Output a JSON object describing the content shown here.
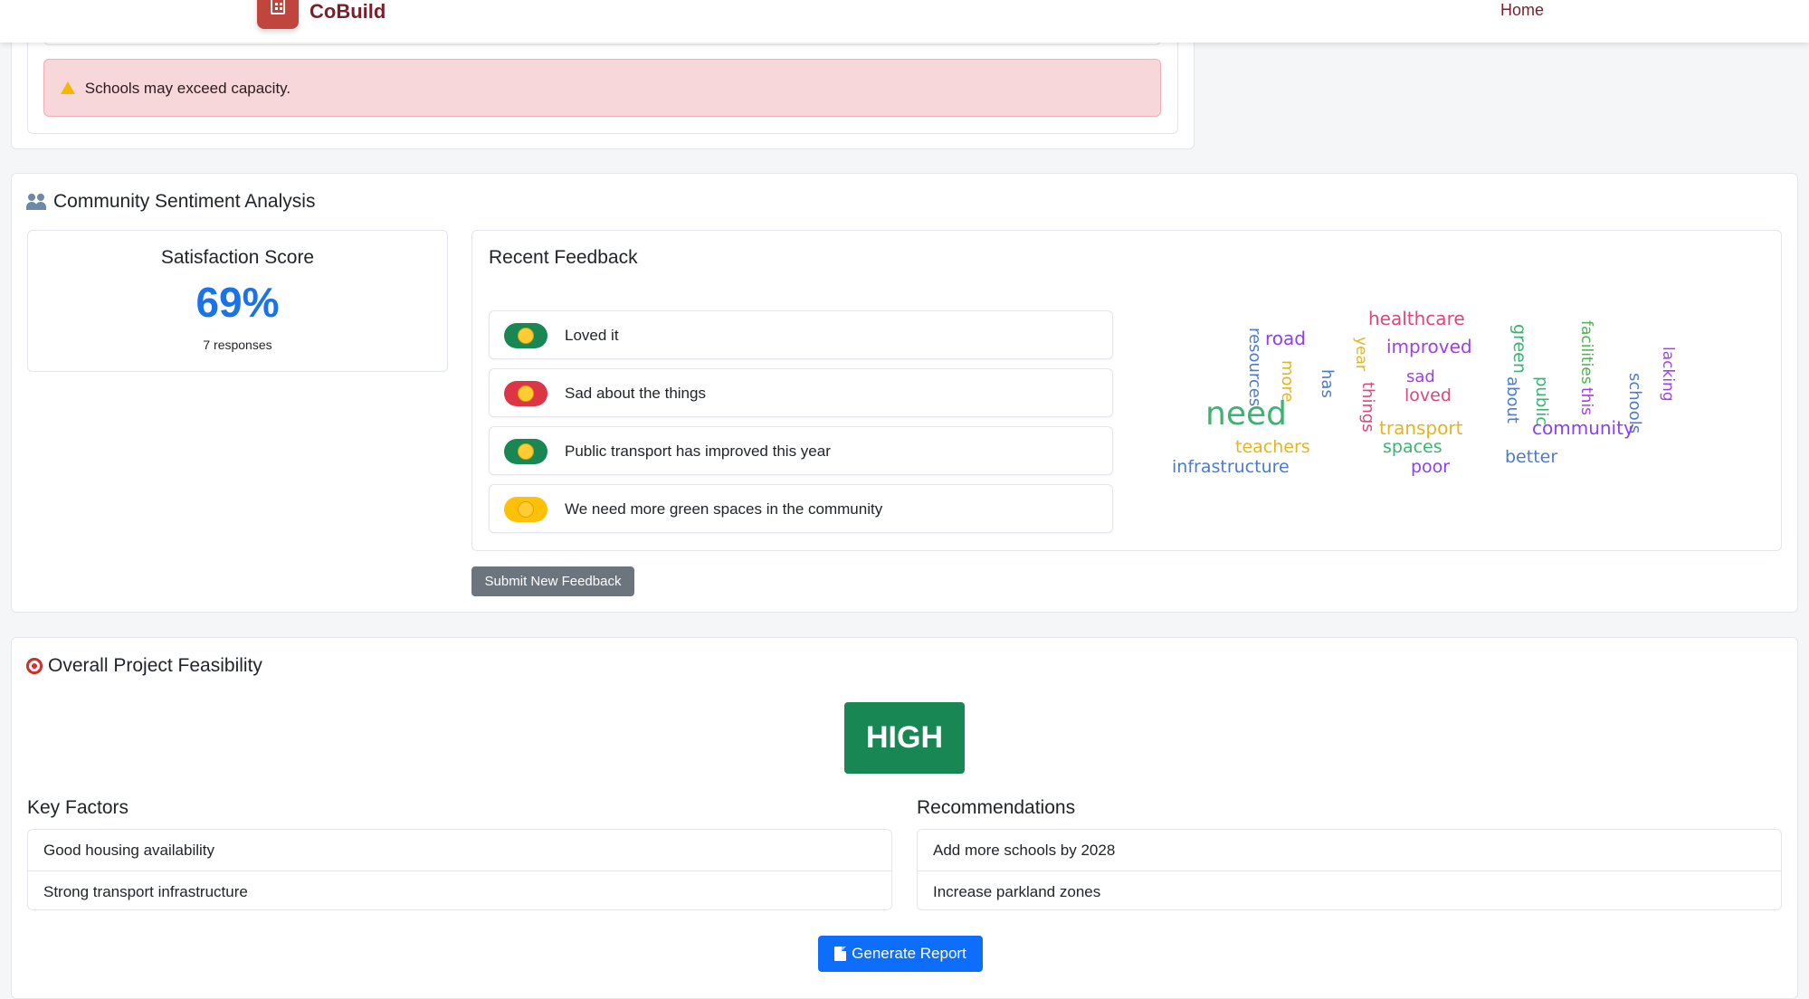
{
  "nav": {
    "brand": "CoBuild",
    "home_link": "Home"
  },
  "alert": {
    "text": "Schools may exceed capacity."
  },
  "sentiment": {
    "title": "Community Sentiment Analysis",
    "score_title": "Satisfaction Score",
    "score_value": "69%",
    "responses": "7 responses",
    "feedback_title": "Recent Feedback",
    "feedback": [
      {
        "text": "Loved it",
        "sentiment": "positive",
        "color": "#198754"
      },
      {
        "text": "Sad about the things",
        "sentiment": "negative",
        "color": "#dc3545"
      },
      {
        "text": "Public transport has improved this year",
        "sentiment": "positive",
        "color": "#198754"
      },
      {
        "text": "We need more green spaces in the community",
        "sentiment": "neutral",
        "color": "#ffc107"
      }
    ],
    "wordcloud": [
      "healthcare",
      "road",
      "resources",
      "year",
      "improved",
      "green",
      "facilities",
      "lacking",
      "more",
      "has",
      "sad",
      "loved",
      "about",
      "public",
      "this",
      "schools",
      "need",
      "things",
      "transport",
      "community",
      "teachers",
      "spaces",
      "infrastructure",
      "poor",
      "better"
    ],
    "submit_label": "Submit New Feedback"
  },
  "feasibility": {
    "title": "Overall Project Feasibility",
    "level": "HIGH",
    "factors_title": "Key Factors",
    "factors": [
      "Good housing availability",
      "Strong transport infrastructure"
    ],
    "recommendations_title": "Recommendations",
    "recommendations": [
      "Add more schools by 2028",
      "Increase parkland zones"
    ],
    "report_label": "Generate Report"
  }
}
